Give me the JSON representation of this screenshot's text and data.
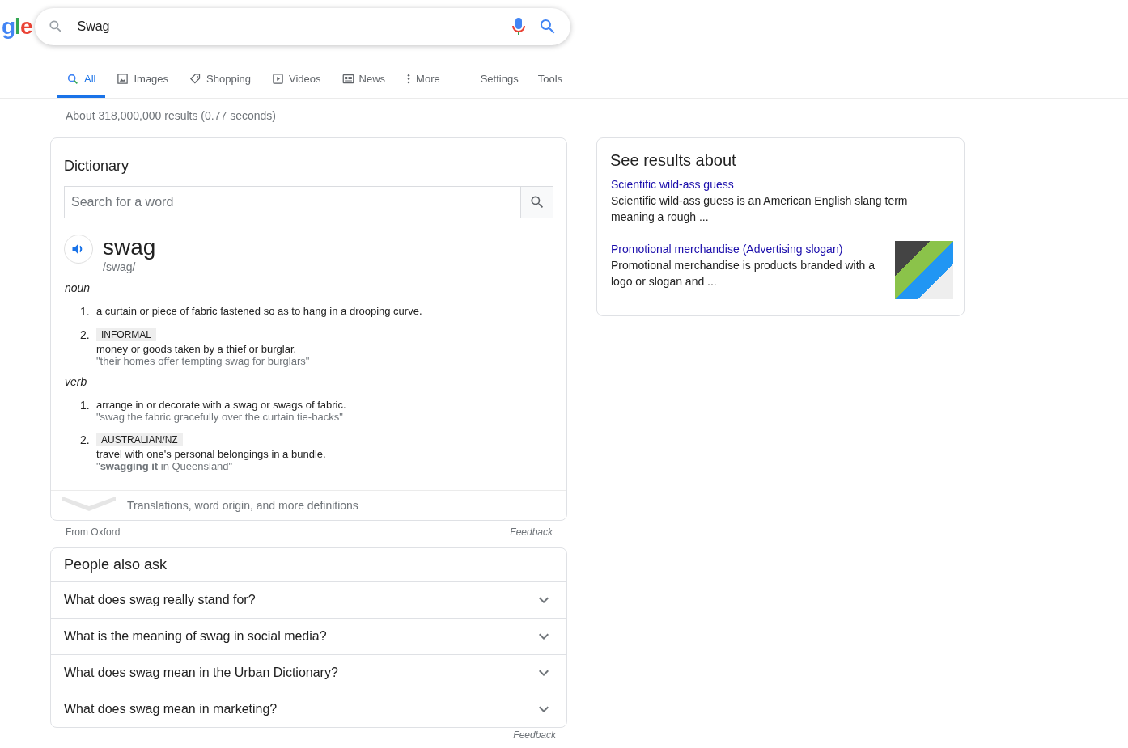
{
  "logo": "gle",
  "search": {
    "value": "Swag"
  },
  "tabs": [
    {
      "label": "All",
      "selected": true,
      "kind": "all"
    },
    {
      "label": "Images",
      "selected": false,
      "kind": "images"
    },
    {
      "label": "Shopping",
      "selected": false,
      "kind": "shopping"
    },
    {
      "label": "Videos",
      "selected": false,
      "kind": "videos"
    },
    {
      "label": "News",
      "selected": false,
      "kind": "news"
    },
    {
      "label": "More",
      "selected": false,
      "kind": "more"
    }
  ],
  "tools": [
    "Settings",
    "Tools"
  ],
  "result_stats": "About 318,000,000 results (0.77 seconds)",
  "dictionary": {
    "title": "Dictionary",
    "search_placeholder": "Search for a word",
    "word": "swag",
    "phonetic": "/swag/",
    "senses": [
      {
        "pos": "noun",
        "definitions": [
          {
            "number": "1.",
            "definition": "a curtain or piece of fabric fastened so as to hang in a drooping curve."
          },
          {
            "number": "2.",
            "label": "INFORMAL",
            "definition": "money or goods taken by a thief or burglar.",
            "example": "\"their homes offer tempting swag for burglars\""
          }
        ]
      },
      {
        "pos": "verb",
        "definitions": [
          {
            "number": "1.",
            "definition": "arrange in or decorate with a swag or swags of fabric.",
            "example": "\"swag the fabric gracefully over the curtain tie-backs\""
          },
          {
            "number": "2.",
            "label": "AUSTRALIAN/NZ",
            "definition": "travel with one's personal belongings in a bundle.",
            "example": "\"**swagging it** in Queensland\""
          }
        ]
      }
    ],
    "more": "Translations, word origin, and more definitions",
    "source": "From Oxford",
    "feedback": "Feedback"
  },
  "people_also_ask": {
    "title": "People also ask",
    "questions": [
      "What does swag really stand for?",
      "What is the meaning of swag in social media?",
      "What does swag mean in the Urban Dictionary?",
      "What does swag mean in marketing?"
    ],
    "feedback": "Feedback"
  },
  "see_results_about": {
    "title": "See results about",
    "items": [
      {
        "title": "Scientific wild-ass guess",
        "snippet": "Scientific wild-ass guess is an American English slang term meaning a rough ...",
        "image": false
      },
      {
        "title": "Promotional merchandise (Advertising slogan)",
        "snippet": "Promotional merchandise is products branded with a logo or slogan and ...",
        "image": true
      }
    ]
  }
}
